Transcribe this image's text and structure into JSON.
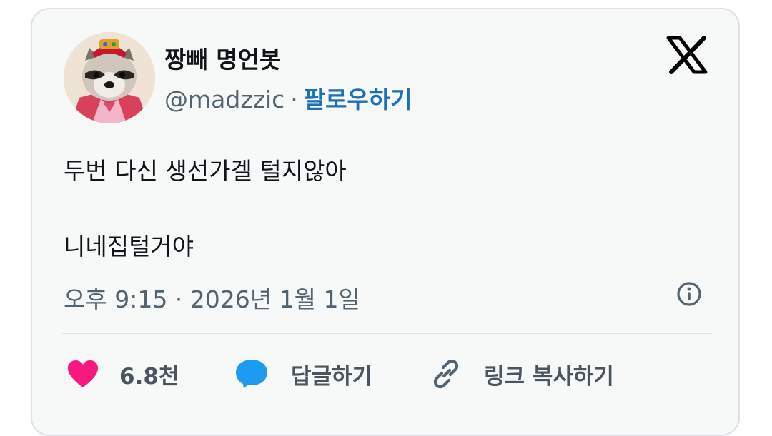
{
  "author": {
    "display_name": "짱빼 명언봇",
    "handle": "@madzzic",
    "separator": "·",
    "follow_label": "팔로우하기"
  },
  "tweet": {
    "line1": "두번 다신 생선가겔 털지않아",
    "line2": "니네집털거야",
    "timestamp": "오후 9:15 · 2026년 1월 1일"
  },
  "actions": {
    "like_count": "6.8천",
    "reply_label": "답글하기",
    "copy_link_label": "링크 복사하기"
  },
  "icons": {
    "logo": "x-logo-icon",
    "info": "info-icon",
    "like": "heart-icon",
    "reply": "speech-bubble-icon",
    "copy": "link-icon"
  },
  "colors": {
    "heart": "#f91880",
    "reply_bubble": "#1d9bf0",
    "follow_link": "#1d6fb8",
    "muted_text": "#536471"
  }
}
